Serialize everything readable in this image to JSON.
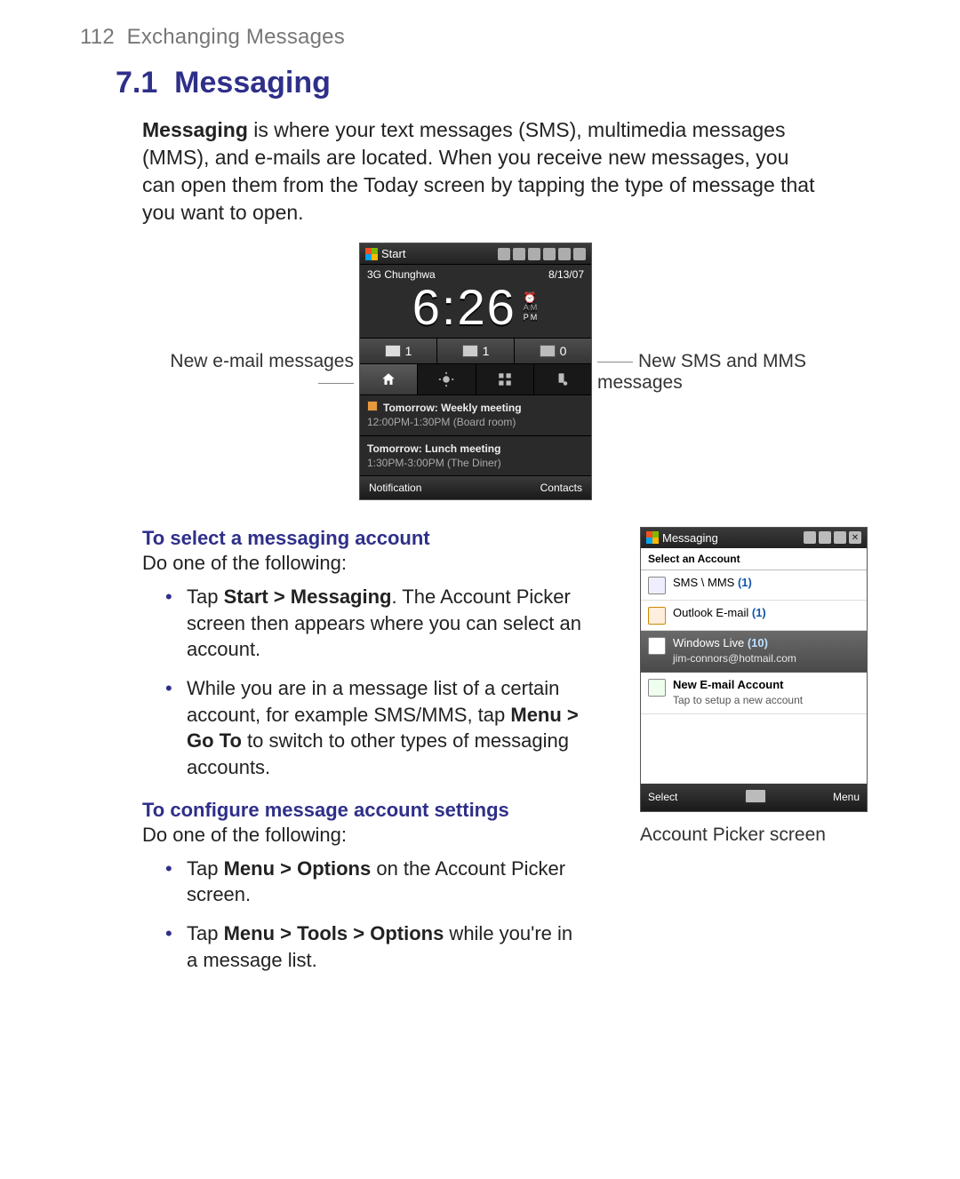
{
  "page_number": "112",
  "chapter_title": "Exchanging Messages",
  "section": {
    "number": "7.1",
    "title": "Messaging"
  },
  "intro_prefix_bold": "Messaging",
  "intro_rest": " is where your text messages (SMS), multimedia messages (MMS), and e-mails are located. When you receive new messages, you can open them from the Today screen by tapping the type of message that you want to open.",
  "callouts": {
    "left": "New e-mail messages",
    "right": "New SMS and MMS messages"
  },
  "today_screen": {
    "start_label": "Start",
    "carrier": "3G Chunghwa",
    "date": "8/13/07",
    "time": "6:26",
    "am": "AM",
    "pm": "PM",
    "alarm_glyph": "⏰",
    "msgcounts": {
      "mail": "1",
      "sms": "1",
      "missed": "0"
    },
    "agenda": [
      {
        "title": "Tomorrow: Weekly meeting",
        "detail": "12:00PM-1:30PM (Board room)"
      },
      {
        "title": "Tomorrow: Lunch meeting",
        "detail": "1:30PM-3:00PM (The Diner)"
      }
    ],
    "softkeys": {
      "left": "Notification",
      "right": "Contacts"
    }
  },
  "select_account": {
    "heading": "To select a messaging account",
    "leadin": "Do one of the following:",
    "bullets": [
      {
        "pre": "Tap ",
        "bold": "Start > Messaging",
        "post": ". The Account Picker screen then appears where you can select an account."
      },
      {
        "pre": "While you are in a message list of a certain account, for example SMS/MMS, tap ",
        "bold": "Menu > Go To",
        "post": " to switch to other types of messaging accounts."
      }
    ]
  },
  "configure_settings": {
    "heading": "To configure message account settings",
    "leadin": "Do one of the following:",
    "bullets": [
      {
        "pre": "Tap ",
        "bold": "Menu > Options",
        "post": " on the Account Picker screen."
      },
      {
        "pre": "Tap ",
        "bold": "Menu > Tools > Options",
        "post": " while you're in a message list."
      }
    ]
  },
  "account_picker": {
    "title": "Messaging",
    "subheader": "Select an Account",
    "close_glyph": "✕",
    "items": [
      {
        "label": "SMS \\ MMS",
        "count": "(1)"
      },
      {
        "label": "Outlook E-mail",
        "count": "(1)"
      },
      {
        "label": "Windows Live",
        "count": "(10)",
        "sub": "jim-connors@hotmail.com",
        "selected": true
      },
      {
        "label": "New E-mail Account",
        "sub": "Tap to setup a new account"
      }
    ],
    "softkeys": {
      "left": "Select",
      "right": "Menu"
    },
    "caption": "Account Picker screen"
  }
}
